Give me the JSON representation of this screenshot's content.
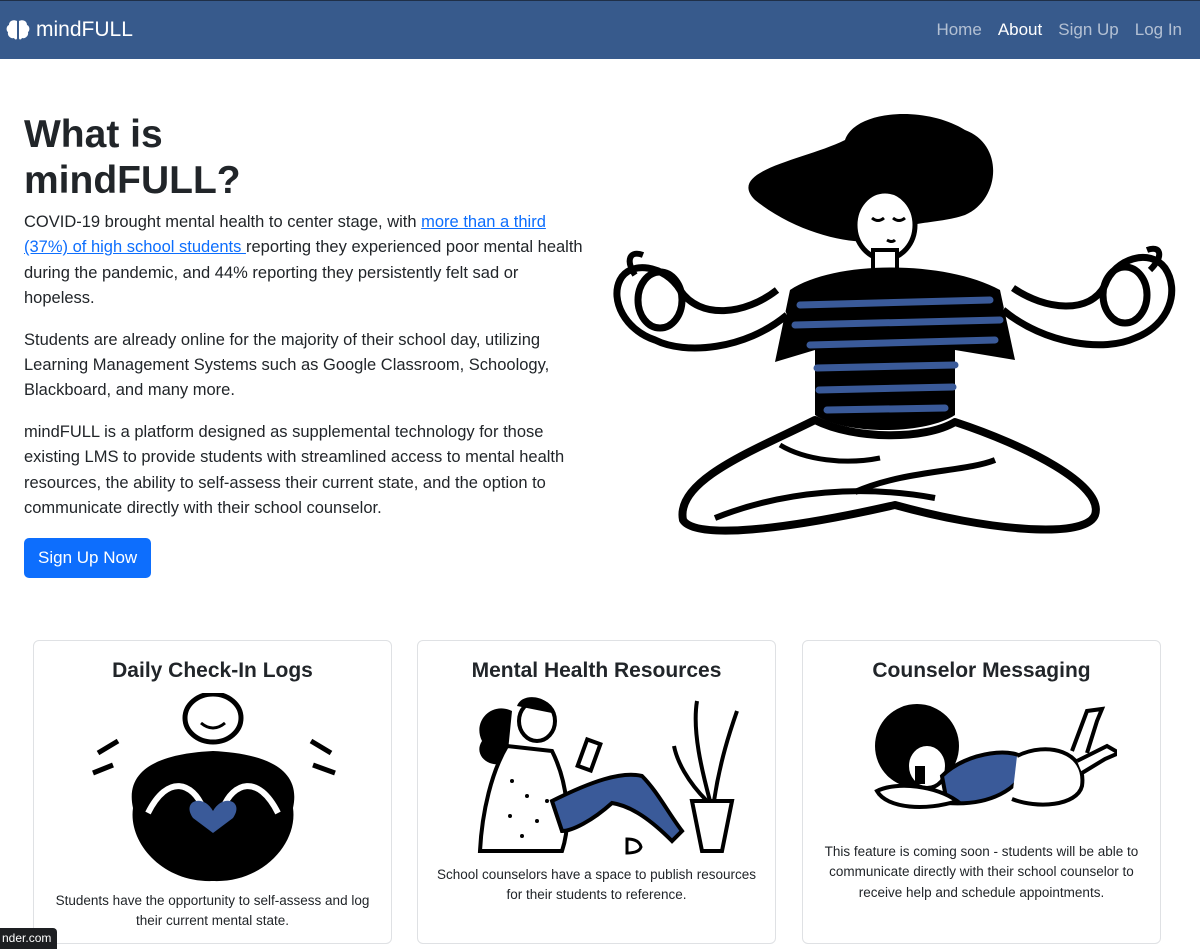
{
  "nav": {
    "brand_icon": "brain-icon",
    "brand": "mindFULL",
    "links": [
      "Home",
      "About",
      "Sign Up",
      "Log In"
    ],
    "active": "About",
    "bg_color": "#375a8c"
  },
  "hero": {
    "title_line1": "What is",
    "title_line2": "mindFULL?",
    "p1_before": "COVID-19 brought mental health to center stage, with ",
    "p1_link": "more than a third (37%) of high school students ",
    "p1_after": "reporting they experienced poor mental health during the pandemic, and 44% reporting they persistently felt sad or hopeless.",
    "p2": "Students are already online for the majority of their school day, utilizing Learning Management Systems such as Google Classroom, Schoology, Blackboard, and many more.",
    "p3": "mindFULL is a platform designed as supplemental technology for those existing LMS to provide students with streamlined access to mental health resources, the ability to self-assess their current state, and the option to communicate directly with their school counselor.",
    "cta": "Sign Up Now",
    "illustration": "meditating-person-illustration"
  },
  "cards": [
    {
      "title": "Daily Check-In Logs",
      "illustration": "heart-hug-illustration",
      "text": "Students have the opportunity to self-assess and log their current mental state."
    },
    {
      "title": "Mental Health Resources",
      "illustration": "reading-person-illustration",
      "text": "School counselors have a space to publish resources for their students to reference."
    },
    {
      "title": "Counselor Messaging",
      "illustration": "phone-person-illustration",
      "text": "This feature is coming soon - students will be able to communicate directly with their school counselor to receive help and schedule appointments."
    }
  ],
  "status_url": "nder.com",
  "colors": {
    "accent": "#0d6efd",
    "illustration_blue": "#3a5a99"
  }
}
